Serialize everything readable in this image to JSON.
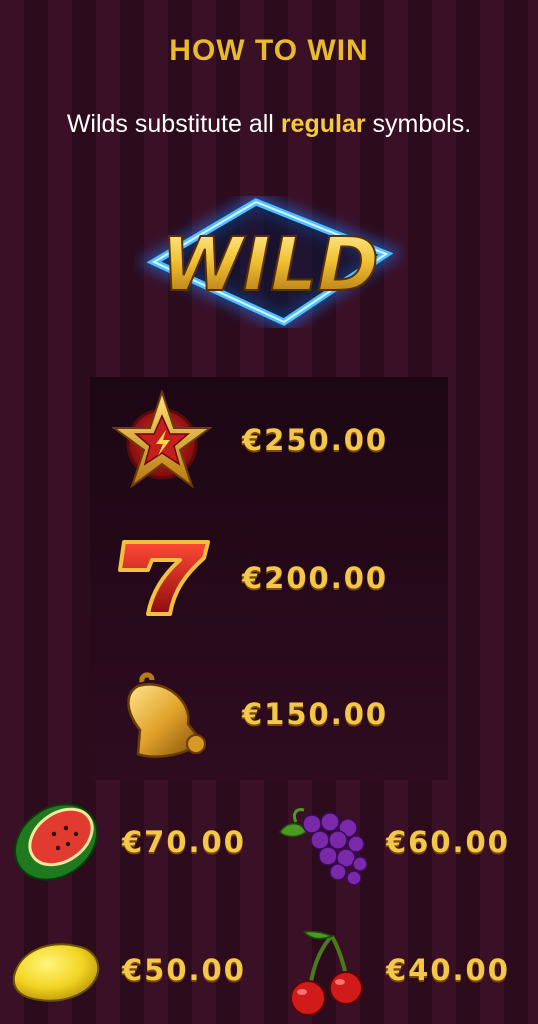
{
  "header": {
    "title": "HOW TO WIN",
    "subtitle_pre": "Wilds substitute all",
    "subtitle_highlight": "regular",
    "subtitle_post": "symbols."
  },
  "wild": {
    "text": "WILD",
    "icon": "wild-logo"
  },
  "paytable": [
    {
      "icon": "star-icon",
      "prize": "€250.00"
    },
    {
      "icon": "seven-icon",
      "prize": "€200.00"
    },
    {
      "icon": "bell-icon",
      "prize": "€150.00"
    },
    {
      "icon": "watermelon-icon",
      "prize": "€70.00"
    },
    {
      "icon": "grapes-icon",
      "prize": "€60.00"
    },
    {
      "icon": "lemon-icon",
      "prize": "€50.00"
    },
    {
      "icon": "cherries-icon",
      "prize": "€40.00"
    }
  ],
  "colors": {
    "gold": "#f3c84a",
    "title": "#e8bb2c",
    "highlight": "#f2cc3a",
    "neon": "#2fa6ff",
    "bg_stripe_a": "#3a1026",
    "bg_stripe_b": "#2c0b1d"
  }
}
